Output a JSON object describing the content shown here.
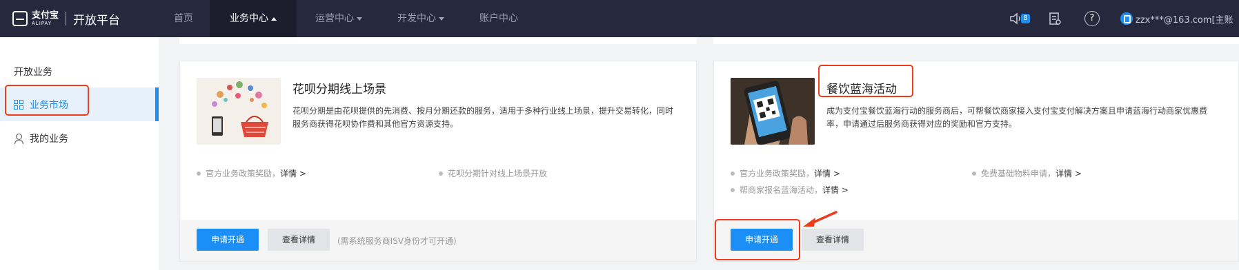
{
  "header": {
    "logo_cn": "支付宝",
    "logo_en": "ALIPAY",
    "platform_title": "开放平台",
    "nav": {
      "home": "首页",
      "business": "业务中心",
      "operations": "运营中心",
      "developer": "开发中心",
      "account": "账户中心"
    },
    "notification_count": "8",
    "help_glyph": "?",
    "user_email": "zzx***@163.com[主账"
  },
  "sidebar": {
    "heading": "开放业务",
    "items": [
      {
        "label": "业务市场",
        "icon": "grid-icon",
        "active": true
      },
      {
        "label": "我的业务",
        "icon": "person-icon",
        "active": false
      }
    ]
  },
  "cards": [
    {
      "title": "花呗分期线上场景",
      "description": "花呗分期是由花呗提供的先消费、按月分期还款的服务，适用于多种行业线上场景，提升交易转化，同时服务商获得花呗协作费和其他官方资源支持。",
      "bullets": [
        {
          "text": "官方业务政策奖励，",
          "detail": "详情 >"
        },
        {
          "text": "花呗分期针对线上场景开放",
          "detail": ""
        }
      ],
      "primary_button": "申请开通",
      "secondary_button": "查看详情",
      "note": "(需系统服务商ISV身份才可开通)"
    },
    {
      "title": "餐饮蓝海活动",
      "description": "成为支付宝餐饮蓝海行动的服务商后，可帮餐饮商家接入支付宝支付解决方案且申请蓝海行动商家优惠费率，申请通过后服务商获得对应的奖励和官方支持。",
      "bullets": [
        {
          "text": "官方业务政策奖励，",
          "detail": "详情 >"
        },
        {
          "text": "免费基础物料申请，",
          "detail": "详情 >"
        },
        {
          "text": "帮商家报名蓝海活动，",
          "detail": "详情 >"
        }
      ],
      "primary_button": "申请开通",
      "secondary_button": "查看详情"
    }
  ],
  "colors": {
    "topbar": "#26293d",
    "accent": "#1b8ff5",
    "annotation": "#ef3b1c"
  }
}
